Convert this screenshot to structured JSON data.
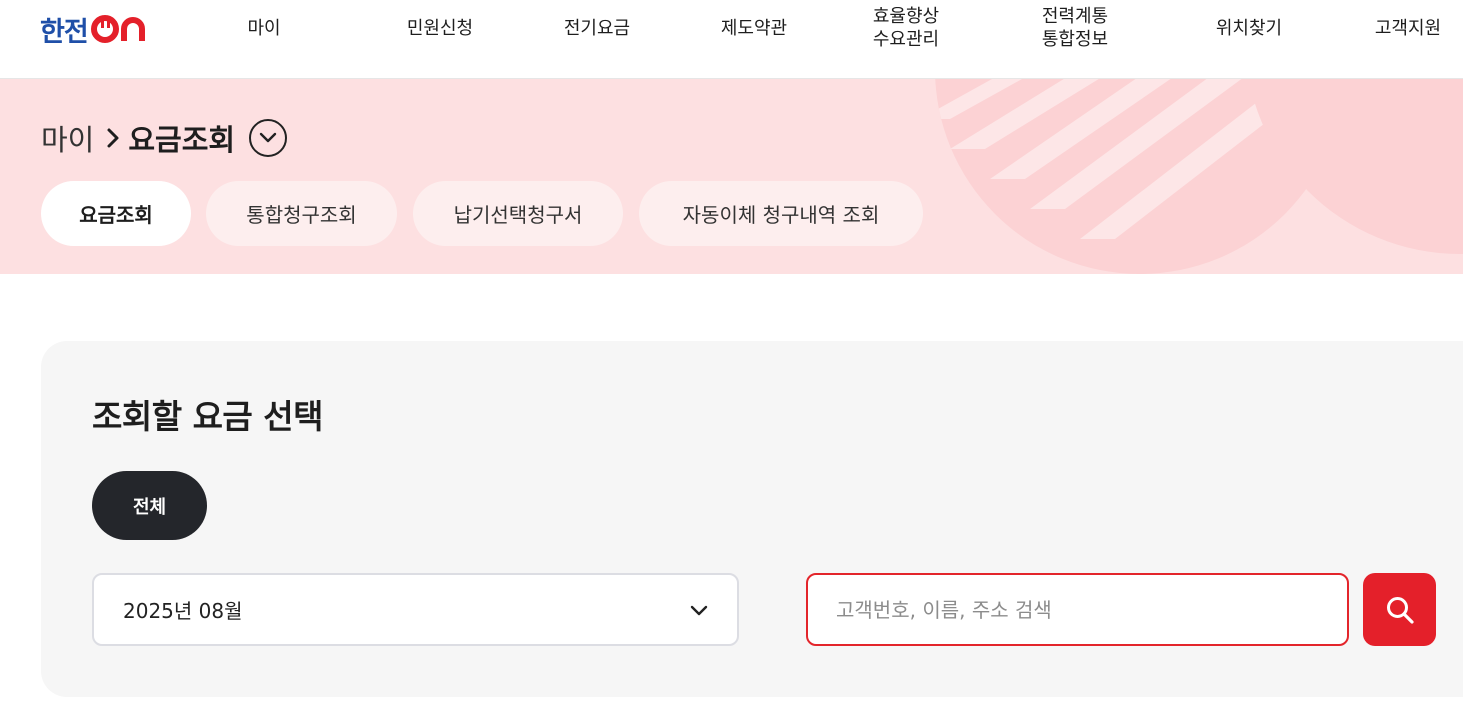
{
  "brand": {
    "logo_text_ko": "한전",
    "logo_text_on": "ON",
    "logo_color": "#1f4fa8",
    "logo_accent": "#e4202a"
  },
  "nav": {
    "items": [
      {
        "label": "마이"
      },
      {
        "label": "민원신청"
      },
      {
        "label": "전기요금"
      },
      {
        "label": "제도약관"
      },
      {
        "label": "효율향상\n수요관리"
      },
      {
        "label": "전력계통\n통합정보"
      },
      {
        "label": "위치찾기"
      },
      {
        "label": "고객지원"
      }
    ]
  },
  "breadcrumb": {
    "home": "마이",
    "current": "요금조회",
    "separator_icon": "chevron-right-icon",
    "toggle_icon": "chevron-down-circle-icon"
  },
  "subtabs": [
    {
      "label": "요금조회",
      "active": true
    },
    {
      "label": "통합청구조회",
      "active": false
    },
    {
      "label": "납기선택청구서",
      "active": false
    },
    {
      "label": "자동이체 청구내역 조회",
      "active": false
    }
  ],
  "search_panel": {
    "title": "조회할 요금 선택",
    "chip_label": "전체",
    "month_select": {
      "value": "2025년 08월",
      "icon": "chevron-down-icon"
    },
    "search": {
      "placeholder": "고객번호, 이름, 주소 검색",
      "value": "",
      "button_icon": "search-icon"
    }
  },
  "colors": {
    "banner_bg": "#fde0e1",
    "accent_red": "#e4202a",
    "chip_dark": "#24262b"
  }
}
